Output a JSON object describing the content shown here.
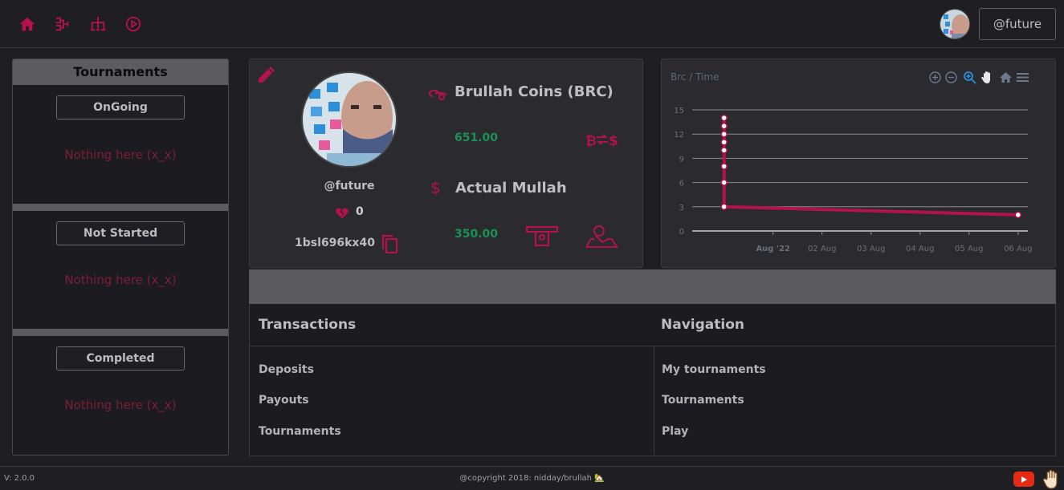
{
  "topbar": {
    "icons": [
      "home-icon",
      "tournament-bracket-icon",
      "hierarchy-icon",
      "play-circle-icon"
    ],
    "username_button": "@future"
  },
  "tournaments": {
    "title": "Tournaments",
    "sections": [
      {
        "label": "OnGoing",
        "empty_text": "Nothing here (x_x)"
      },
      {
        "label": "Not Started",
        "empty_text": "Nothing here (x_x)"
      },
      {
        "label": "Completed",
        "empty_text": "Nothing here (x_x)"
      }
    ]
  },
  "profile": {
    "username": "@future",
    "hearts": "0",
    "wallet_id": "1bsl696kx40",
    "coins_title": "Brullah Coins (BRC)",
    "coins_value": "651.00",
    "mullah_icon": "$",
    "mullah_title": "Actual Mullah",
    "mullah_value": "350.00"
  },
  "chart_data": {
    "type": "line",
    "title": "Brc / Time",
    "ylim": [
      0,
      15
    ],
    "yticks": [
      "0",
      "3",
      "6",
      "9",
      "12",
      "15"
    ],
    "xticks": [
      "Aug '22",
      "02 Aug",
      "03 Aug",
      "04 Aug",
      "05 Aug",
      "06 Aug"
    ],
    "grid": true,
    "series": [
      {
        "values": [
          {
            "x": "2022-07-31",
            "y": 14
          },
          {
            "x": "2022-07-31",
            "y": 13
          },
          {
            "x": "2022-07-31",
            "y": 12
          },
          {
            "x": "2022-07-31",
            "y": 11
          },
          {
            "x": "2022-07-31",
            "y": 10
          },
          {
            "x": "2022-07-31",
            "y": 8
          },
          {
            "x": "2022-07-31",
            "y": 6
          },
          {
            "x": "2022-07-31",
            "y": 3
          },
          {
            "x": "2022-08-06",
            "y": 2
          }
        ]
      }
    ],
    "color": "#b3124a",
    "toolbar": [
      "zoom-in-icon",
      "zoom-out-icon",
      "zoom-select-icon",
      "pan-icon",
      "reset-home-icon",
      "menu-icon"
    ]
  },
  "transactions": {
    "title": "Transactions",
    "links": [
      "Deposits",
      "Payouts",
      "Tournaments"
    ]
  },
  "navigation": {
    "title": "Navigation",
    "links": [
      "My tournaments",
      "Tournaments",
      "Play"
    ]
  },
  "footer": {
    "version": "V: 2.0.0",
    "copyright": "@copyright 2018: nidday/brullah 🏡"
  },
  "colors": {
    "accent": "#b3124a",
    "positive": "#1a9255",
    "empty_text": "#7d1e36",
    "background": "#1f1e23",
    "card": "#2b2a2f"
  }
}
